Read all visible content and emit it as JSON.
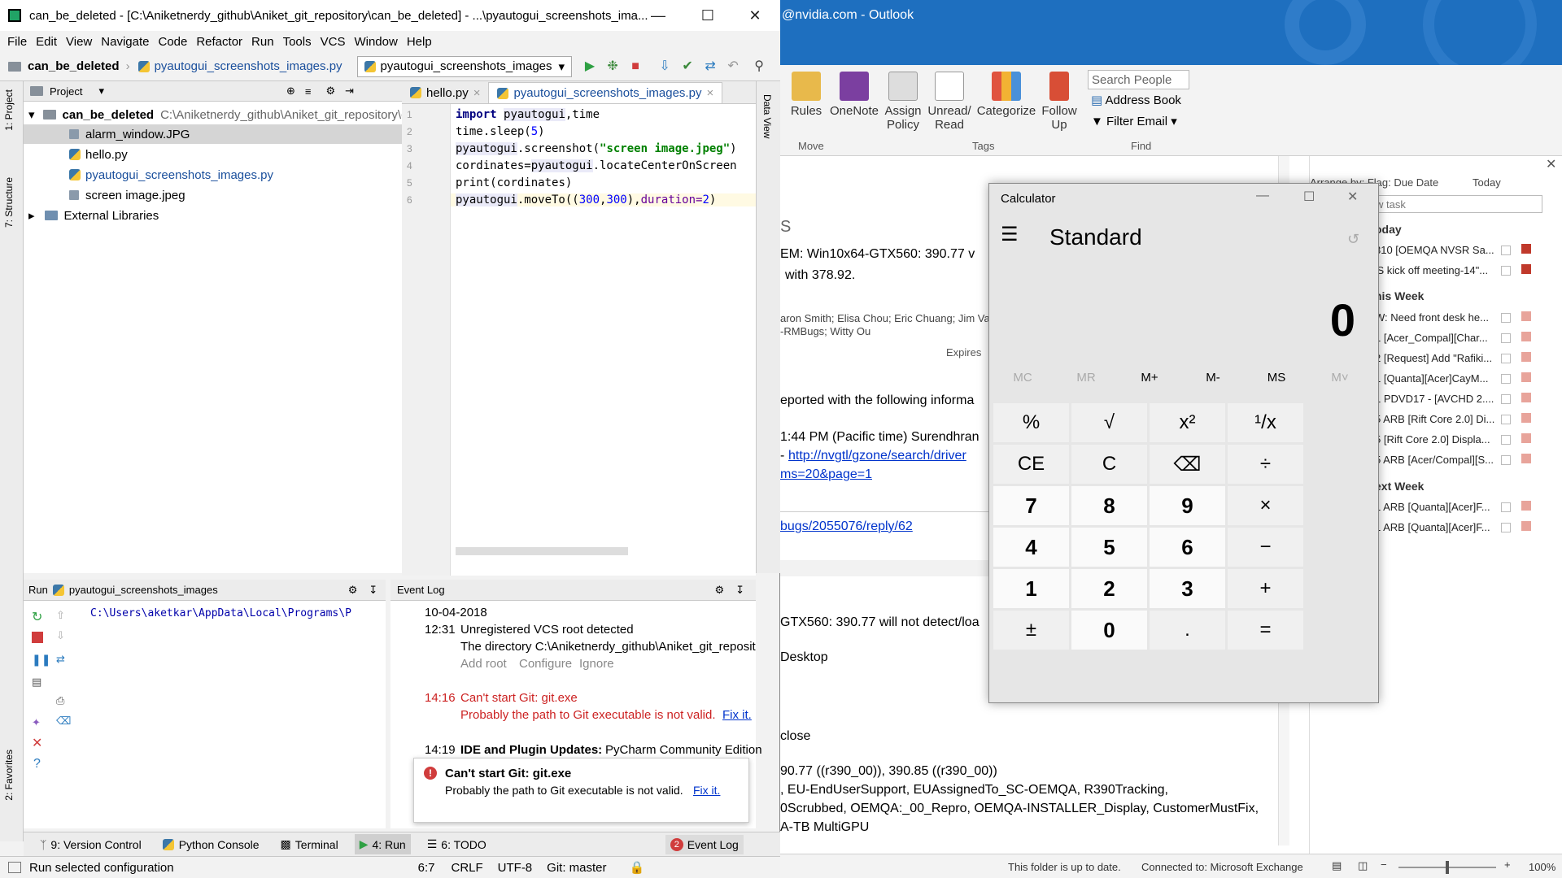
{
  "pycharm": {
    "title": "can_be_deleted - [C:\\Aniketnerdy_github\\Aniket_git_repository\\can_be_deleted] - ...\\pyautogui_screenshots_ima...",
    "menu": [
      "File",
      "Edit",
      "View",
      "Navigate",
      "Code",
      "Refactor",
      "Run",
      "Tools",
      "VCS",
      "Window",
      "Help"
    ],
    "breadcrumb": {
      "project": "can_be_deleted",
      "file": "pyautogui_screenshots_images.py"
    },
    "run_config": "pyautogui_screenshots_images",
    "left_tabs": {
      "project": "1: Project",
      "structure": "7: Structure",
      "favorites": "2: Favorites"
    },
    "project_panel": {
      "title": "Project",
      "root_name": "can_be_deleted",
      "root_path": "C:\\Aniketnerdy_github\\Aniket_git_repository\\c",
      "files": [
        "alarm_window.JPG",
        "hello.py",
        "pyautogui_screenshots_images.py",
        "screen image.jpeg"
      ],
      "external": "External Libraries"
    },
    "editor_tabs": [
      "hello.py",
      "pyautogui_screenshots_images.py"
    ],
    "line_numbers": [
      "1",
      "2",
      "3",
      "4",
      "5",
      "6"
    ],
    "code": {
      "l1a": "import ",
      "l1b": "pyautogui",
      "l1c": ",time",
      "l2a": "time.sleep(",
      "l2b": "5",
      "l2c": ")",
      "l3a": "pyautogui",
      ".": "",
      "l3b": ".screenshot(",
      "l3c": "\"screen image.jpeg\"",
      "l3d": ")",
      "l4a": "cordinates=",
      "l4b": "pyautogui",
      "l4c": ".locateCenterOnScreen",
      "l5a": "print",
      "l5b": "(cordinates)",
      "l6a": "pyautogui",
      "l6b": ".moveTo((",
      "l6c": "300",
      "l6d": ",",
      "l6e": "300",
      "l6f": "),",
      "l6g": "duration=",
      "l6h": "2",
      "l6i": ")"
    },
    "data_view": "Data View",
    "run_panel": {
      "label": "Run",
      "config": "pyautogui_screenshots_images",
      "output": "C:\\Users\\aketkar\\AppData\\Local\\Programs\\P"
    },
    "event_log": {
      "title": "Event Log",
      "date": "10-04-2018",
      "e1_time": "12:31",
      "e1_title": "Unregistered VCS root detected",
      "e1_body": "The directory C:\\Aniketnerdy_github\\Aniket_git_reposit",
      "e1_add": "Add root",
      "e1_conf": "Configure",
      "e1_ign": "Ignore",
      "e2_time": "14:16",
      "e2_title": "Can't start Git: git.exe",
      "e2_body": "Probably the path to Git executable is not valid.",
      "e2_fix": "Fix it.",
      "e3_time": "14:19",
      "e3_title": "IDE and Plugin Updates:",
      "e3_body": "PyCharm Community Edition"
    },
    "popup": {
      "title": "Can't start Git: git.exe",
      "body": "Probably the path to Git executable is not valid.",
      "fix": "Fix it."
    },
    "bottom_tabs": {
      "vc": "9: Version Control",
      "py": "Python Console",
      "term": "Terminal",
      "run": "4: Run",
      "todo": "6: TODO",
      "evt": "Event Log",
      "evt_badge": "2"
    },
    "status": {
      "msg": "Run selected configuration",
      "pos": "6:7",
      "crlf": "CRLF",
      "enc": "UTF-8",
      "git": "Git: master"
    }
  },
  "outlook": {
    "title": "@nvidia.com - Outlook",
    "ribbon": {
      "rules": "Rules",
      "onenote": "OneNote",
      "assign": "Assign",
      "policy": "Policy",
      "unread": "Unread/",
      "read": "Read",
      "categorize": "Categorize",
      "follow": "Follow",
      "up": "Up",
      "search_people": "Search People",
      "address_book": "Address Book",
      "filter_email": "Filter Email",
      "g_move": "Move",
      "g_tags": "Tags",
      "g_find": "Find"
    },
    "mail": {
      "s": "S",
      "line1": "EM: Win10x64-GTX560: 390.77 v",
      "line2": "with 378.92.",
      "people": "aron Smith; Elisa Chou; Eric Chuang; Jim Var",
      "rm": "-RMBugs; Witty Ou",
      "expires": "Expires",
      "body1": "eported with the following informa",
      "body2": "1:44 PM (Pacific time) Surendhran",
      "link1": "http://nvgtl/gzone/search/driver",
      "link1b": "ms=20&page=1",
      "dash": "-",
      "link2": "bugs/2055076/reply/62",
      "b3": "GTX560: 390.77 will not detect/loa",
      "b4": "Desktop",
      "b5": "close",
      "b6": "90.77 ((r390_00)), 390.85 ((r390_00))",
      "b7": ", EU-EndUserSupport, EUAssignedTo_SC-OEMQA, R390Tracking,",
      "b8": "0Scrubbed, OEMQA:_00_Repro, OEMQA-INSTALLER_Display, CustomerMustFix,",
      "b9": "A-TB  MultiGPU"
    },
    "tasks": {
      "arrange": "Arrange by: Flag: Due Date",
      "today_sort": "Today",
      "new_task": "w task",
      "today": "oday",
      "this_week": "his Week",
      "next_week": "ext Week",
      "items": [
        "310 [OEMQA NVSR Sa...",
        "'S kick off meeting-14\"...",
        "W: Need front desk he...",
        "1 [Acer_Compal][Char...",
        "2 [Request] Add \"Rafiki...",
        "1 [Quanta][Acer]CayM...",
        "1 PDVD17 - [AVCHD 2....",
        "5 ARB [Rift Core 2.0] Di...",
        "5 [Rift Core 2.0] Displa...",
        "5 ARB [Acer/Compal][S...",
        "1 ARB [Quanta][Acer]F...",
        "1 ARB [Quanta][Acer]F..."
      ]
    },
    "status": {
      "sync": "This folder is up to date.",
      "conn": "Connected to: Microsoft Exchange",
      "zoom": "100%"
    }
  },
  "calculator": {
    "title": "Calculator",
    "mode": "Standard",
    "display": "0",
    "memory": [
      "MC",
      "MR",
      "M+",
      "M-",
      "MS",
      "M˅"
    ],
    "keys": [
      "%",
      "√",
      "x²",
      "¹/x",
      "CE",
      "C",
      "⌫",
      "÷",
      "7",
      "8",
      "9",
      "×",
      "4",
      "5",
      "6",
      "−",
      "1",
      "2",
      "3",
      "+",
      "±",
      "0",
      ".",
      "="
    ]
  },
  "colors": {
    "outlook_blue": "#1e6fbf",
    "flag_red": "#c0392b",
    "error_red": "#cc2222",
    "link_blue": "#0033cc"
  }
}
